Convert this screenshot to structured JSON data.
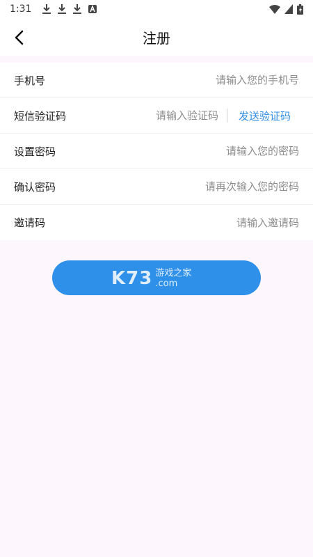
{
  "status_bar": {
    "time": "1:31",
    "notification_icons": [
      "download-icon",
      "download-icon",
      "download-icon",
      "a-icon"
    ],
    "right_icons": [
      "wifi-icon",
      "signal-icon",
      "battery-icon"
    ]
  },
  "header": {
    "title": "注册",
    "back_icon": "chevron-left-icon"
  },
  "form": {
    "phone": {
      "label": "手机号",
      "placeholder": "请输入您的手机号",
      "value": ""
    },
    "sms_code": {
      "label": "短信验证码",
      "placeholder": "请输入验证码",
      "value": "",
      "send_label": "发送验证码"
    },
    "password": {
      "label": "设置密码",
      "placeholder": "请输入您的密码",
      "value": ""
    },
    "confirm_password": {
      "label": "确认密码",
      "placeholder": "请再次输入您的密码",
      "value": ""
    },
    "invite_code": {
      "label": "邀请码",
      "placeholder": "请输入邀请码",
      "value": ""
    }
  },
  "submit": {
    "label": ""
  },
  "watermark": {
    "brand": "K73",
    "line1": "游戏之家",
    "line2": ".com"
  },
  "colors": {
    "accent": "#2f90ea",
    "link": "#2f8de6",
    "background": "#fdf7fd"
  }
}
